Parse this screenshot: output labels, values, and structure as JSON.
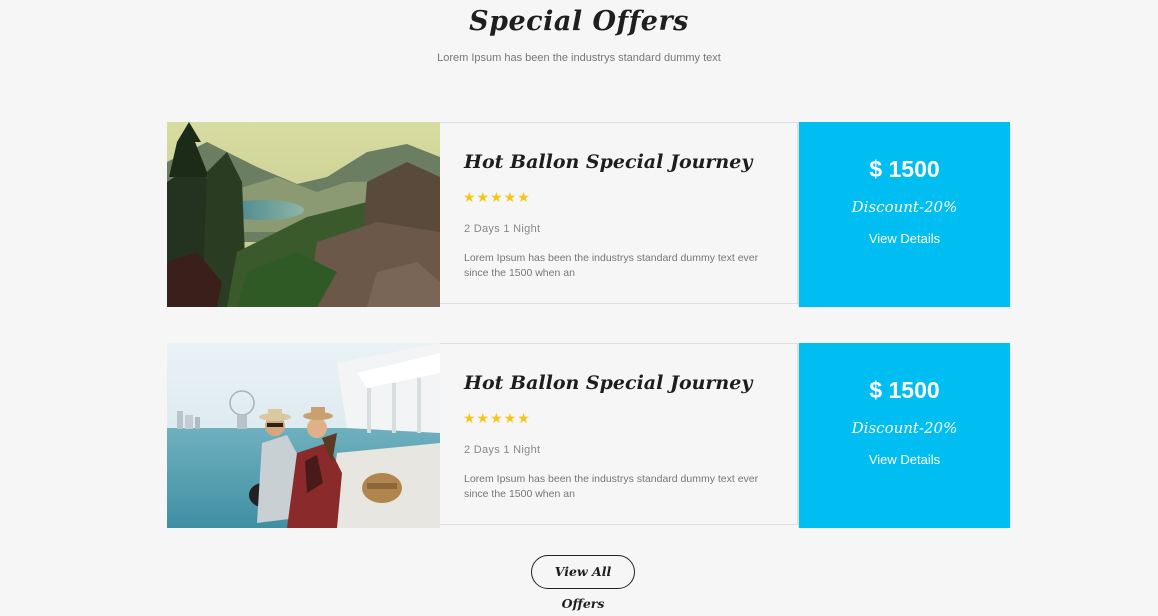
{
  "section": {
    "title": "Special Offers",
    "subtitle": "Lorem Ipsum has been the industrys standard dummy text"
  },
  "offers": [
    {
      "title": "Hot Ballon Special Journey",
      "rating": 5,
      "stars": "★★★★★",
      "duration": "2 Days 1 Night",
      "description": "Lorem Ipsum has been the industrys standard dummy text ever since the 1500 when an",
      "price": "$ 1500",
      "discount": "Discount-20%",
      "details_label": "View Details",
      "image": "mountain-lake-photo"
    },
    {
      "title": "Hot Ballon Special Journey",
      "rating": 5,
      "stars": "★★★★★",
      "duration": "2 Days 1 Night",
      "description": "Lorem Ipsum has been the industrys standard dummy text ever since the 1500 when an",
      "price": "$ 1500",
      "discount": "Discount-20%",
      "details_label": "View Details",
      "image": "travel-couple-seaside-photo"
    }
  ],
  "view_all_label": "View All Offers",
  "colors": {
    "accent": "#00bef2",
    "star": "#f5c518",
    "background": "#f6f6f6"
  }
}
